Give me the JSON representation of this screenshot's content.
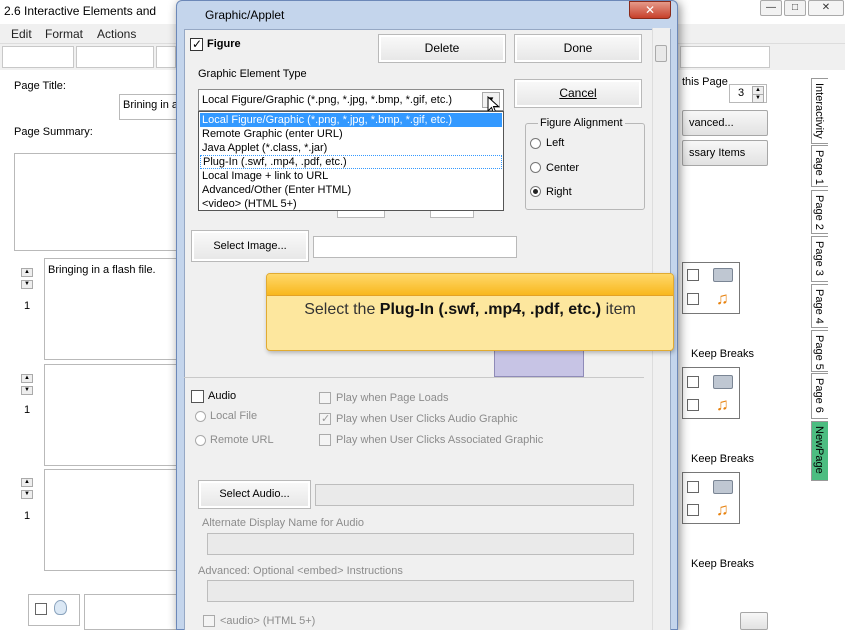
{
  "app": {
    "title": "2.6 Interactive Elements and",
    "window_buttons": [
      "—",
      "□",
      "✕"
    ],
    "menu": [
      "Edit",
      "Format",
      "Actions"
    ]
  },
  "page": {
    "page_title_label": "Page Title:",
    "page_title_value": "Brining in a",
    "page_summary_label": "Page Summary:",
    "first_text_block": "Bringing in a flash file.",
    "item_numbers": [
      "1",
      "1",
      "1"
    ],
    "on_this_page_label": "this Page",
    "on_this_page_value": "3",
    "advanced_button": "vanced...",
    "necessary_items_button": "ssary Items",
    "keep_breaks_label": "Keep Breaks"
  },
  "tabs": [
    "Interactivity",
    "Page 1",
    "Page 2",
    "Page 3",
    "Page 4",
    "Page 5",
    "Page 6",
    "NewPage"
  ],
  "dialog": {
    "title": "Graphic/Applet",
    "close_glyph": "✕",
    "figure_label": "Figure",
    "delete_label": "Delete",
    "done_label": "Done",
    "cancel_label": "Cancel",
    "graphic_type_label": "Graphic Element Type",
    "graphic_type_selected": "Local Figure/Graphic (*.png, *.jpg, *.bmp, *.gif, etc.)",
    "graphic_type_options": [
      "Local Figure/Graphic (*.png, *.jpg, *.bmp, *.gif, etc.)",
      "Remote Graphic (enter URL)",
      "Java Applet (*.class, *.jar)",
      "Plug-In (.swf, .mp4, .pdf, etc.)",
      "Local Image + link to URL",
      "Advanced/Other (Enter HTML)",
      "<video> (HTML 5+)"
    ],
    "alignment_label": "Figure Alignment",
    "alignment_options": [
      "Left",
      "Center",
      "Right"
    ],
    "alignment_selected": "Right",
    "select_image_label": "Select Image...",
    "audio_label": "Audio",
    "local_file_label": "Local File",
    "remote_url_label": "Remote URL",
    "play_page_loads": "Play when Page Loads",
    "play_audio_graphic": "Play when User Clicks Audio Graphic",
    "play_associated_graphic": "Play when User Clicks Associated Graphic",
    "select_audio_label": "Select Audio...",
    "alt_name_label": "Alternate Display Name for Audio",
    "embed_label": "Advanced: Optional <embed> Instructions",
    "audio_html5_label": "<audio> (HTML 5+)"
  },
  "tooltip": {
    "prefix": "Select the ",
    "bold": "Plug-In (.swf, .mp4, .pdf, etc.)",
    "suffix": " item"
  },
  "colors": {
    "dialog_frame": "#c4d5ec",
    "selection": "#3399ff",
    "tooltip_bg": "#fde79e",
    "tooltip_band": "#f8b81e",
    "active_tab": "#4cbd81"
  }
}
